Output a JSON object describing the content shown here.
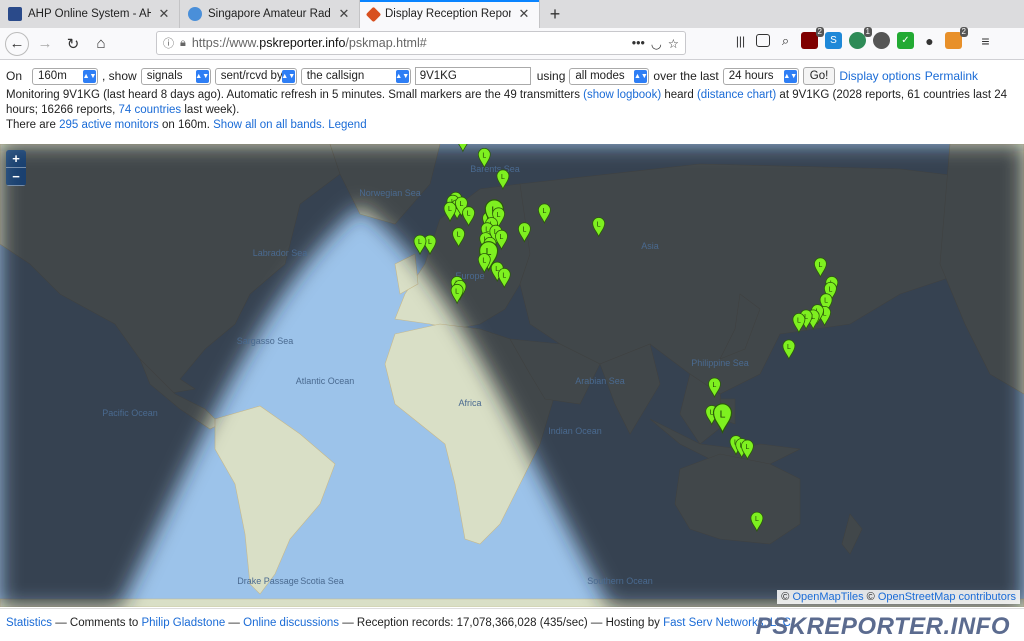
{
  "browser": {
    "tabs": [
      {
        "title": "AHP Online System - AHP-OS",
        "active": false,
        "favicon_color": "#2a4a8a"
      },
      {
        "title": "Singapore Amateur Radio Transmitting",
        "active": false,
        "favicon_color": "#4a8fd9"
      },
      {
        "title": "Display Reception Reports",
        "active": true,
        "favicon_color": "#d8501f"
      }
    ],
    "new_tab": "+",
    "url_scheme": "https://www.",
    "url_domain": "pskreporter.info",
    "url_path": "/pskmap.html#",
    "url_menu": "•••",
    "toolbar_badges": [
      "2",
      "1",
      "2"
    ]
  },
  "controls": {
    "on_label": "On",
    "band": "160m",
    "show_label": ", show",
    "what": "signals",
    "direction": "sent/rcvd by",
    "target": "the callsign",
    "callsign": "9V1KG",
    "using_label": "using",
    "mode": "all modes",
    "over_label": "over the last",
    "period": "24 hours",
    "go": "Go!",
    "display_options": "Display options",
    "permalink": "Permalink"
  },
  "info": {
    "line1_a": "Monitoring 9V1KG (last heard 8 days ago). Automatic refresh in 5 minutes. Small markers are the 49 transmitters ",
    "show_logbook": "(show logbook)",
    "line1_b": " heard ",
    "distance_chart": "(distance chart)",
    "line1_c": " at 9V1KG (2028 reports, 61 countries last 24 hours; 16266 reports, ",
    "countries_link": "74 countries",
    "line1_d": " last week).",
    "line2_a": "There are ",
    "active_monitors": "295 active monitors",
    "line2_b": " on 160m. ",
    "show_all": "Show all on all bands.",
    "legend": "Legend"
  },
  "map": {
    "zoom_in": "+",
    "zoom_out": "−",
    "attrib_copy1": "©",
    "attrib_omt": "OpenMapTiles",
    "attrib_copy2": "©",
    "attrib_osm": "OpenStreetMap contributors",
    "labels": [
      "Labrador Sea",
      "Sargasso Sea",
      "Atlantic Ocean",
      "Pacific Ocean",
      "Indian Ocean",
      "Southern Ocean",
      "Scotia Sea",
      "Drake Passage",
      "Philippine Sea",
      "Arabian Sea",
      "Norwegian Sea",
      "Barents Sea",
      "Africa",
      "Europe",
      "Asia"
    ],
    "marker_letter": "L",
    "markers": [
      {
        "lon": 13.0,
        "lat": 70.0,
        "big": false
      },
      {
        "lon": 20.5,
        "lat": 68.0,
        "big": false
      },
      {
        "lon": 27.0,
        "lat": 65.0,
        "big": false
      },
      {
        "lon": 10.5,
        "lat": 61.5,
        "big": false
      },
      {
        "lon": 9.5,
        "lat": 61.0,
        "big": false
      },
      {
        "lon": 11.0,
        "lat": 60.2,
        "big": false
      },
      {
        "lon": 12.5,
        "lat": 60.7,
        "big": false
      },
      {
        "lon": 15.0,
        "lat": 59.0,
        "big": false
      },
      {
        "lon": 8.5,
        "lat": 59.8,
        "big": false
      },
      {
        "lon": 22.0,
        "lat": 58.0,
        "big": false
      },
      {
        "lon": 24.0,
        "lat": 58.5,
        "big": true
      },
      {
        "lon": 25.5,
        "lat": 58.8,
        "big": false
      },
      {
        "lon": 23.0,
        "lat": 57.0,
        "big": false
      },
      {
        "lon": 21.5,
        "lat": 56.0,
        "big": false
      },
      {
        "lon": 24.5,
        "lat": 55.5,
        "big": false
      },
      {
        "lon": 26.5,
        "lat": 54.5,
        "big": false
      },
      {
        "lon": 21.0,
        "lat": 54.0,
        "big": false
      },
      {
        "lon": 22.5,
        "lat": 53.0,
        "big": false
      },
      {
        "lon": 34.5,
        "lat": 56.0,
        "big": false
      },
      {
        "lon": 41.5,
        "lat": 59.5,
        "big": false
      },
      {
        "lon": 60.5,
        "lat": 57.0,
        "big": false
      },
      {
        "lon": 1.5,
        "lat": 53.5,
        "big": false
      },
      {
        "lon": -2.0,
        "lat": 53.5,
        "big": false
      },
      {
        "lon": 11.5,
        "lat": 55.0,
        "big": false
      },
      {
        "lon": 22.0,
        "lat": 50.0,
        "big": true
      },
      {
        "lon": 20.5,
        "lat": 49.5,
        "big": false
      },
      {
        "lon": 25.0,
        "lat": 47.5,
        "big": false
      },
      {
        "lon": 27.5,
        "lat": 46.0,
        "big": false
      },
      {
        "lon": 11.0,
        "lat": 44.0,
        "big": false
      },
      {
        "lon": 12.0,
        "lat": 43.0,
        "big": false
      },
      {
        "lon": 11.0,
        "lat": 42.0,
        "big": false
      },
      {
        "lon": 138.0,
        "lat": 48.5,
        "big": false
      },
      {
        "lon": 142.0,
        "lat": 44.0,
        "big": false
      },
      {
        "lon": 141.5,
        "lat": 42.5,
        "big": false
      },
      {
        "lon": 140.0,
        "lat": 39.5,
        "big": false
      },
      {
        "lon": 139.5,
        "lat": 36.0,
        "big": false
      },
      {
        "lon": 137.0,
        "lat": 36.5,
        "big": false
      },
      {
        "lon": 135.5,
        "lat": 35.0,
        "big": false
      },
      {
        "lon": 133.0,
        "lat": 35.0,
        "big": false
      },
      {
        "lon": 130.5,
        "lat": 34.0,
        "big": false
      },
      {
        "lon": 127.0,
        "lat": 26.0,
        "big": false
      },
      {
        "lon": 101.0,
        "lat": 13.5,
        "big": false
      },
      {
        "lon": 100.0,
        "lat": 4.0,
        "big": false
      },
      {
        "lon": 103.8,
        "lat": 1.3,
        "big": true
      },
      {
        "lon": 108.5,
        "lat": -6.5,
        "big": false
      },
      {
        "lon": 110.5,
        "lat": -7.5,
        "big": false
      },
      {
        "lon": 112.5,
        "lat": -8.0,
        "big": false
      },
      {
        "lon": 115.8,
        "lat": -31.5,
        "big": false
      }
    ]
  },
  "footer": {
    "statistics": "Statistics",
    "t1": " — Comments to ",
    "author": "Philip Gladstone",
    "t2": " — ",
    "discussions": "Online discussions",
    "t3": " — Reception records: 17,078,366,028 (435/sec) — Hosting by ",
    "hosting": "Fast Serv Networks, LLC",
    "brand": "PSKREPORTER.INFO"
  }
}
